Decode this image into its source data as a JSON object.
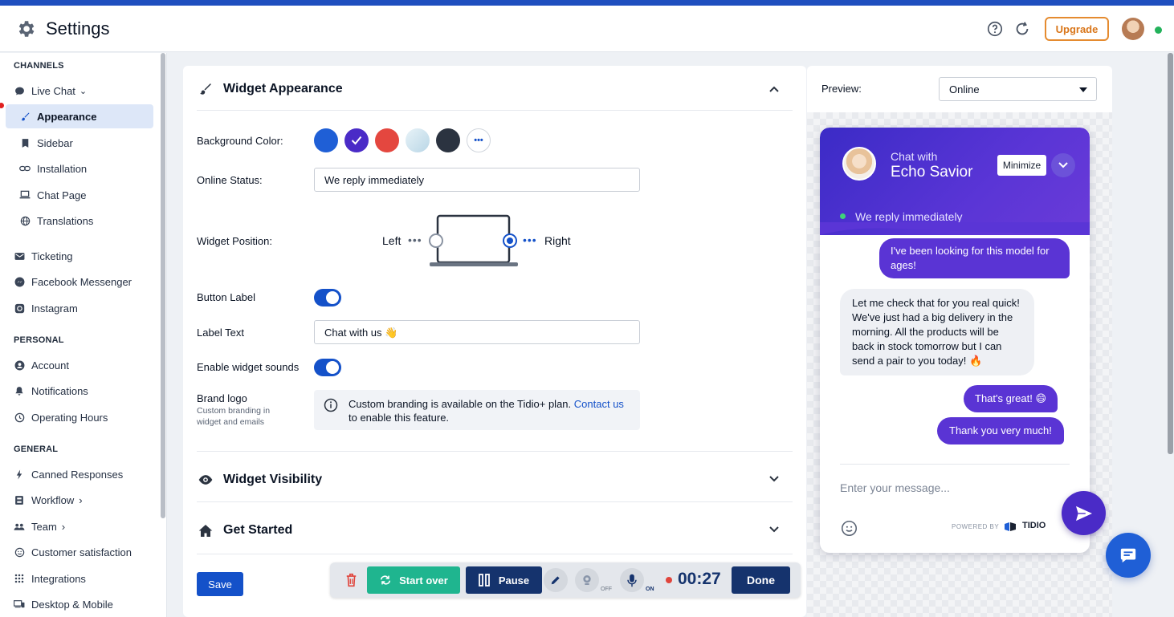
{
  "header": {
    "title": "Settings",
    "upgrade_label": "Upgrade",
    "icons": [
      "gear-icon",
      "help-icon",
      "refresh-icon"
    ]
  },
  "sidebar": {
    "sections": [
      {
        "label": "CHANNELS"
      },
      {
        "label": "PERSONAL"
      },
      {
        "label": "GENERAL"
      }
    ],
    "items": [
      {
        "label": "Live Chat",
        "icon": "chat-bubble-icon",
        "suffix": "⌄"
      },
      {
        "label": "Appearance",
        "icon": "brush-icon",
        "active": true
      },
      {
        "label": "Sidebar",
        "icon": "bookmark-icon"
      },
      {
        "label": "Installation",
        "icon": "link-icon"
      },
      {
        "label": "Chat Page",
        "icon": "laptop-icon"
      },
      {
        "label": "Translations",
        "icon": "globe-icon"
      },
      {
        "label": "Ticketing",
        "icon": "mail-icon"
      },
      {
        "label": "Facebook Messenger",
        "icon": "messenger-icon"
      },
      {
        "label": "Instagram",
        "icon": "instagram-icon"
      },
      {
        "label": "Account",
        "icon": "user-icon"
      },
      {
        "label": "Notifications",
        "icon": "bell-icon"
      },
      {
        "label": "Operating Hours",
        "icon": "clock-icon"
      },
      {
        "label": "Canned Responses",
        "icon": "bolt-icon"
      },
      {
        "label": "Workflow",
        "icon": "workflow-icon",
        "suffix": "›"
      },
      {
        "label": "Team",
        "icon": "team-icon",
        "suffix": "›"
      },
      {
        "label": "Customer satisfaction",
        "icon": "smile-icon"
      },
      {
        "label": "Integrations",
        "icon": "grid-icon"
      },
      {
        "label": "Desktop & Mobile",
        "icon": "devices-icon"
      }
    ]
  },
  "appearance": {
    "section_title": "Widget Appearance",
    "background_color_label": "Background Color:",
    "colors": [
      "#1f5fd6",
      "#4a2bc7",
      "#e4473f",
      "#cfe4ef",
      "#2b3340"
    ],
    "selected_color": "#4a2bc7",
    "more_label": "•••",
    "online_status_label": "Online Status:",
    "online_status_value": "We reply immediately",
    "widget_position_label": "Widget Position:",
    "position_left": "Left",
    "position_right": "Right",
    "position_selected": "Right",
    "button_label_label": "Button Label",
    "button_label_on": true,
    "label_text_label": "Label Text",
    "label_text_value": "Chat with us 👋",
    "sounds_label": "Enable widget sounds",
    "sounds_on": true,
    "brand_logo_label": "Brand logo",
    "brand_logo_sub": "Custom branding in widget and emails",
    "brand_info_text": "Custom branding is available on the Tidio+ plan.",
    "brand_info_link": "Contact us",
    "brand_info_tail": "to enable this feature."
  },
  "visibility": {
    "section_title": "Widget Visibility"
  },
  "get_started": {
    "section_title": "Get Started"
  },
  "save_label": "Save",
  "recorder": {
    "start_over_label": "Start over",
    "pause_label": "Pause",
    "off_label": "OFF",
    "on_label": "ON",
    "timer": "00:27",
    "done_label": "Done"
  },
  "preview": {
    "label": "Preview:",
    "select_value": "Online",
    "chat_with": "Chat with",
    "agent_name": "Echo Savior",
    "minimize_label": "Minimize",
    "status": "We reply immediately",
    "messages": [
      {
        "from": "visitor",
        "text": "I've been looking for this model for ages!"
      },
      {
        "from": "agent",
        "text": "Let me check that for you real quick! We've just had a big delivery in the morning. All the products will be back in stock tomorrow but I can send a pair to you today! 🔥"
      },
      {
        "from": "visitor",
        "text": "That's great! 😄"
      },
      {
        "from": "visitor",
        "text": "Thank you very much!"
      }
    ],
    "composer_placeholder": "Enter your message...",
    "powered_by": "POWERED BY",
    "brand": "TIDIO"
  }
}
